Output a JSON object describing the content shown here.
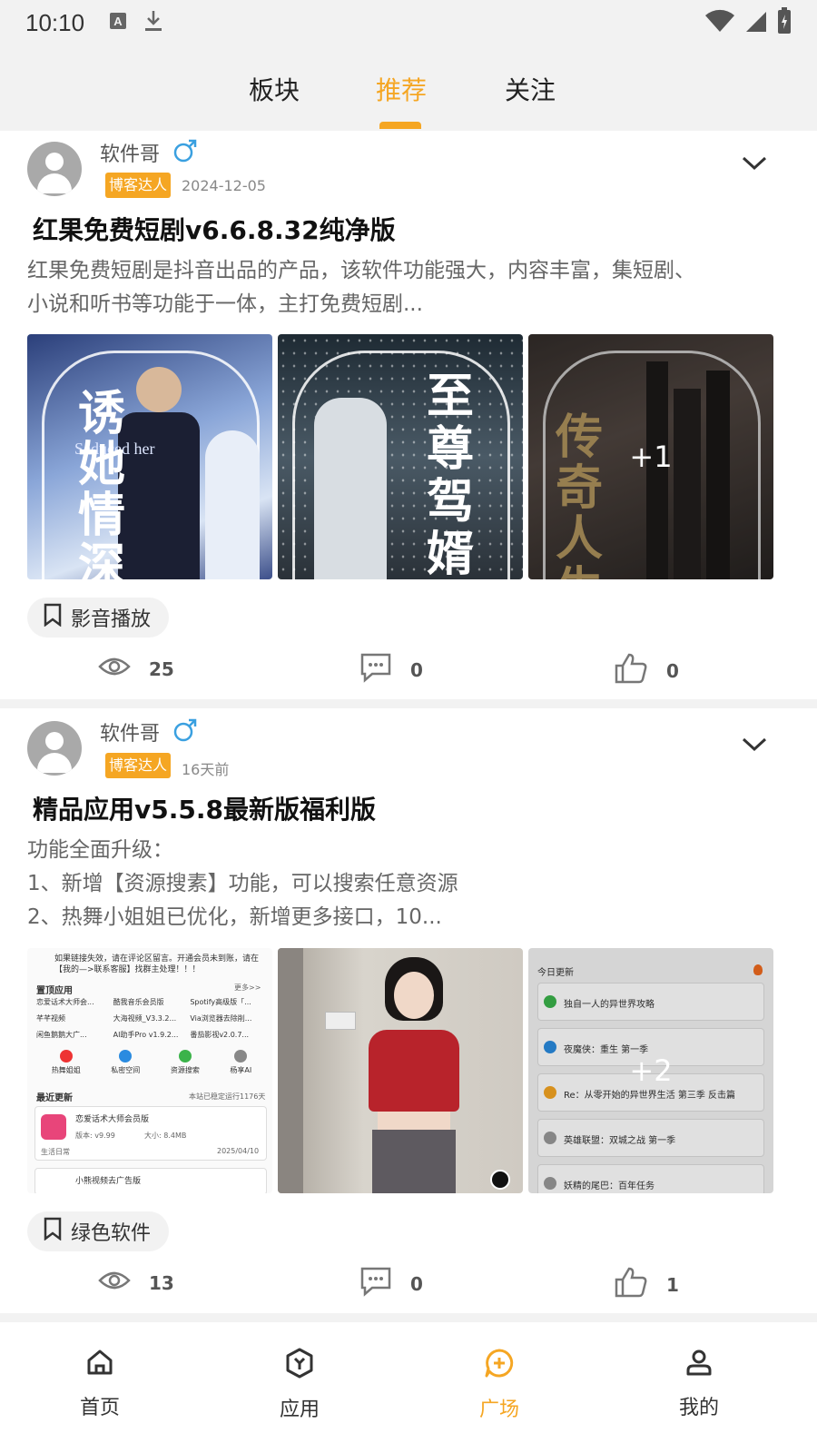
{
  "status_bar": {
    "time": "10:10"
  },
  "top_tabs": [
    {
      "label": "板块",
      "active": false
    },
    {
      "label": "推荐",
      "active": true
    },
    {
      "label": "关注",
      "active": false
    }
  ],
  "accent_color": "#f5a623",
  "posts": [
    {
      "author": "软件哥",
      "badge": "博客达人",
      "date": "2024-12-05",
      "title": "红果免费短剧v6.6.8.32纯净版",
      "description": "红果免费短剧是抖音出品的产品，该软件功能强大，内容丰富，集短剧、\n小说和听书等功能于一体，主打免费短剧...",
      "images": [
        {
          "text": "诱她情深",
          "subtitle": "Seduced her"
        },
        {
          "text": "至尊驾婿"
        },
        {
          "text": "传奇人生",
          "more": "+1"
        }
      ],
      "tag": "影音播放",
      "views": "25",
      "comments": "0",
      "likes": "0"
    },
    {
      "author": "软件哥",
      "badge": "博客达人",
      "date": "16天前",
      "title": "精品应用v5.5.8最新版福利版",
      "description": "功能全面升级：\n1、新增【资源搜素】功能，可以搜索任意资源\n2、热舞小姐姐已优化，新增更多接口，10...",
      "images": [
        {
          "notice": "如果链接失效，请在评论区留言。开通会员未到账，请在【我的—>联系客服】找群主处理！！！",
          "section_top": "置顶应用",
          "section_more": "更多>>",
          "apps": [
            "恋爱话术大师会...",
            "酷我音乐会员版",
            "Spotify高级版「...",
            "芊芊视频",
            "大海视频_V3.3.2...",
            "Via浏览器去除削...",
            "闲鱼鹅鹅大广...",
            "AI助手Pro v1.9.2...",
            "番茄影视v2.0.7..."
          ],
          "shortcuts": [
            "热舞姐姐",
            "私密空间",
            "资源搜索",
            "杨享AI"
          ],
          "section_latest": "最近更新",
          "latest_note": "本站已稳定运行1176天",
          "card_title": "恋爱话术大师会员版",
          "card_version": "版本: v9.99",
          "card_size": "大小: 8.4MB",
          "card_category": "生活日常",
          "card_date": "2025/04/10",
          "card2_title": "小熊视频去广告版"
        },
        {
          "text": ""
        },
        {
          "header": "今日更新",
          "items": [
            "独自一人的异世界攻略",
            "夜魔侠：重生 第一季",
            "Re：从零开始的异世界生活 第三季 反击篇",
            "英雄联盟：双城之战 第一季",
            "妖精的尾巴：百年任务"
          ],
          "more": "+2"
        }
      ],
      "tag": "绿色软件",
      "views": "13",
      "comments": "0",
      "likes": "1"
    }
  ],
  "bottom_nav": [
    {
      "label": "首页",
      "icon": "home-icon",
      "active": false
    },
    {
      "label": "应用",
      "icon": "apps-cube-icon",
      "active": false
    },
    {
      "label": "广场",
      "icon": "square-chat-plus-icon",
      "active": true
    },
    {
      "label": "我的",
      "icon": "profile-icon",
      "active": false
    }
  ]
}
